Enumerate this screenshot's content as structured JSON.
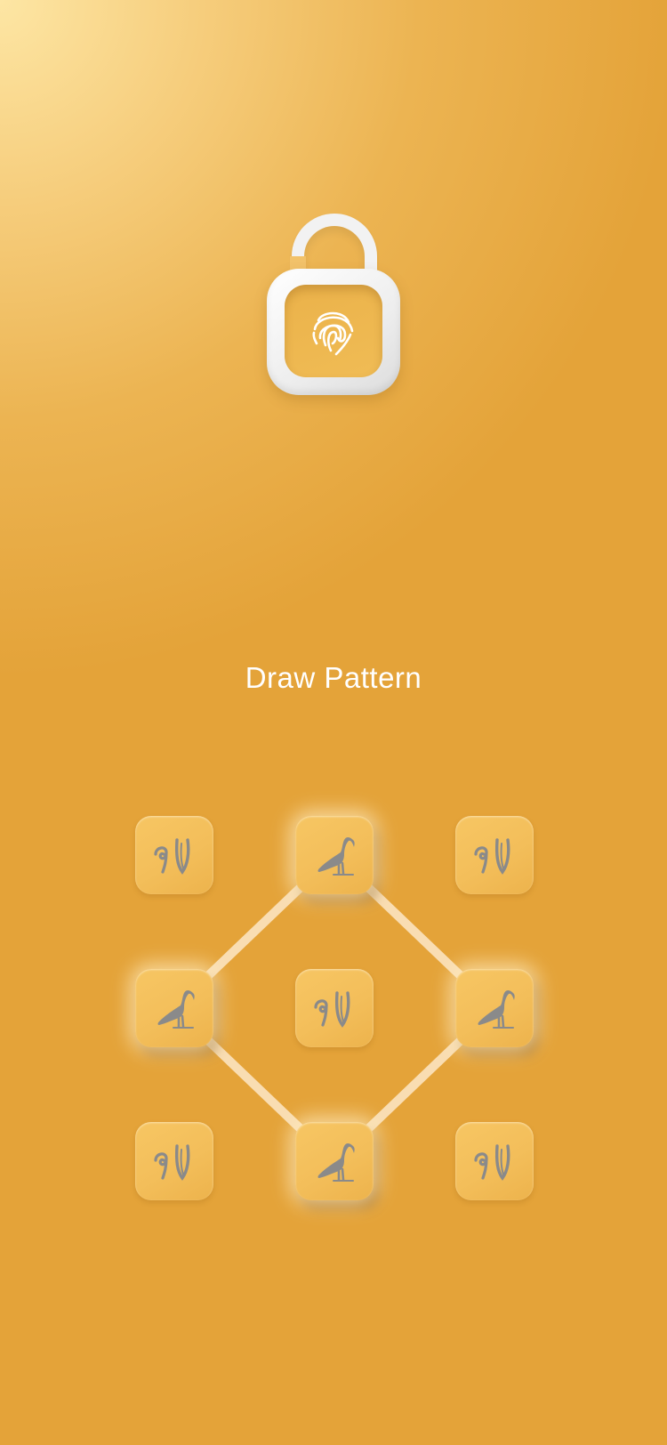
{
  "screen": {
    "title": "Draw Pattern",
    "lock_icon": "padlock-fingerprint-icon"
  },
  "pattern": {
    "rows": 3,
    "cols": 3,
    "selected": [
      1,
      3,
      5,
      7
    ],
    "path_order": [
      3,
      1,
      5,
      7,
      3
    ],
    "active_glyph": "ibis-hieroglyph-icon",
    "inactive_glyph": "hieroglyph-icon"
  },
  "colors": {
    "background": "#e4a339",
    "highlight": "#fde6a4",
    "tile": "#f3be5a",
    "glyph": "#8a8a8a",
    "line": "#fde7c8"
  }
}
